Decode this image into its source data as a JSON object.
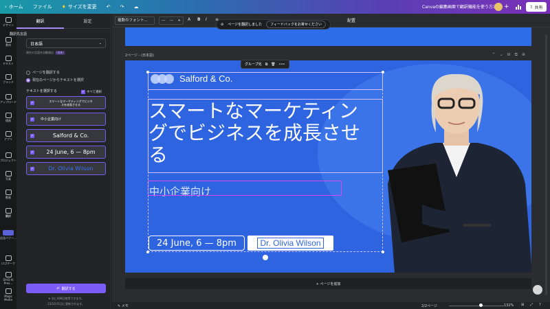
{
  "topbar": {
    "home": "ホーム",
    "file": "ファイル",
    "resize": "サイズを変更",
    "doc_title": "Canvaの編集画面で翻訳機能を使う方法",
    "share": "共有"
  },
  "rail": [
    {
      "icon": "layout-icon",
      "label": "デザイン"
    },
    {
      "icon": "elements-icon",
      "label": "素材"
    },
    {
      "icon": "text-icon",
      "label": "テキスト"
    },
    {
      "icon": "brand-icon",
      "label": "ブランド"
    },
    {
      "icon": "upload-icon",
      "label": "アップロード"
    },
    {
      "icon": "draw-icon",
      "label": "描画"
    },
    {
      "icon": "apps-icon",
      "label": "アプリ"
    },
    {
      "icon": "projects-icon",
      "label": "プロジェクト"
    },
    {
      "icon": "photo-icon",
      "label": "写真"
    },
    {
      "icon": "video-icon",
      "label": "動画"
    },
    {
      "icon": "translate-icon",
      "label": "翻訳"
    },
    {
      "icon": "thumb",
      "label": "広告バナー..."
    },
    {
      "icon": "logo-icon",
      "label": "ロゴマーク"
    },
    {
      "icon": "drive-icon",
      "label": "DI-ID Ai Pres..."
    },
    {
      "icon": "magic-icon",
      "label": "Magic Media"
    }
  ],
  "panel": {
    "tab_translate": "翻訳",
    "tab_settings": "設定",
    "target_lang_label": "翻訳先言語",
    "target_lang_value": "日本語",
    "detect_note": "現在の言語を自動検出",
    "detect_badge": "(編集)",
    "radio_page": "ページを翻訳する",
    "radio_selected": "現在のページからテキストを選択",
    "select_text_label": "テキストを選択する",
    "select_all": "すべて選択",
    "items": [
      "スマートなマーケティングでビジネスを成長させる",
      "中小企業向け",
      "Salford & Co.",
      "24 June, 6 — 8pm",
      "Dr. Olivia Wilson"
    ],
    "translate_btn": "翻訳する",
    "foot1": "★ 次に488回使用できます。",
    "foot2": "23/10/31日に更新されます。"
  },
  "toolbar": {
    "font": "複数のフォント...",
    "size_minus": "—",
    "size_value": "—",
    "size_plus": "+",
    "position": "配置"
  },
  "toast": {
    "message": "ページを翻訳しました",
    "feedback": "フィードバックをお寄せください"
  },
  "canvas": {
    "page_label": "2ページ - (日本語)",
    "group_label": "グループ化",
    "add_page": "+ ページを追加"
  },
  "slide": {
    "logo_text": "Salford & Co.",
    "headline": "スマートなマーケティングでビジネスを成長させる",
    "sub": "中小企業向け",
    "date": "24 June, 6 — 8pm",
    "name": "Dr. Olivia Wilson"
  },
  "bottombar": {
    "notes": "メモ",
    "pages": "2/2ページ",
    "zoom": "132%"
  }
}
